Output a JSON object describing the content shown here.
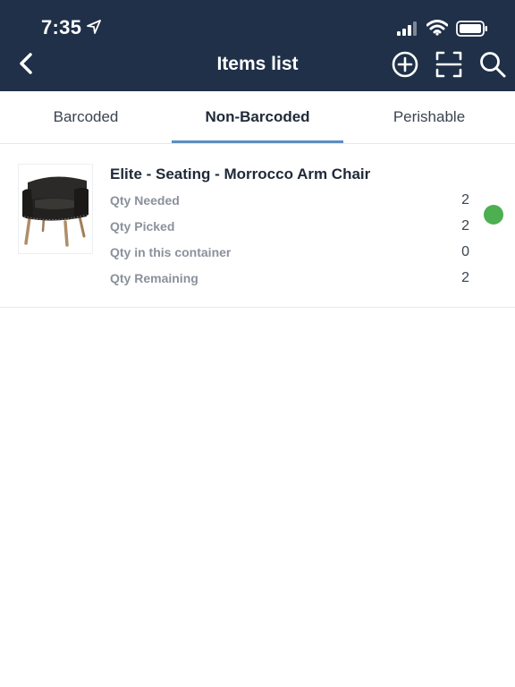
{
  "status_bar": {
    "time": "7:35"
  },
  "header": {
    "title": "Items list",
    "background": "#1f3048"
  },
  "tabs": [
    {
      "label": "Barcoded",
      "active": false
    },
    {
      "label": "Non-Barcoded",
      "active": true
    },
    {
      "label": "Perishable",
      "active": false
    }
  ],
  "accent_color": "#5b8ec2",
  "items": [
    {
      "name": "Elite - Seating - Morrocco Arm Chair",
      "rows": [
        {
          "label": "Qty Needed",
          "value": "2"
        },
        {
          "label": "Qty Picked",
          "value": "2"
        },
        {
          "label": "Qty in this container",
          "value": "0"
        },
        {
          "label": "Qty Remaining",
          "value": "2"
        }
      ],
      "status_color": "#4caf50",
      "image": "armchair-image"
    }
  ],
  "icons": {
    "back": "chevron-left-icon",
    "add": "plus-circle-icon",
    "scan": "scan-frame-icon",
    "search": "search-icon"
  }
}
